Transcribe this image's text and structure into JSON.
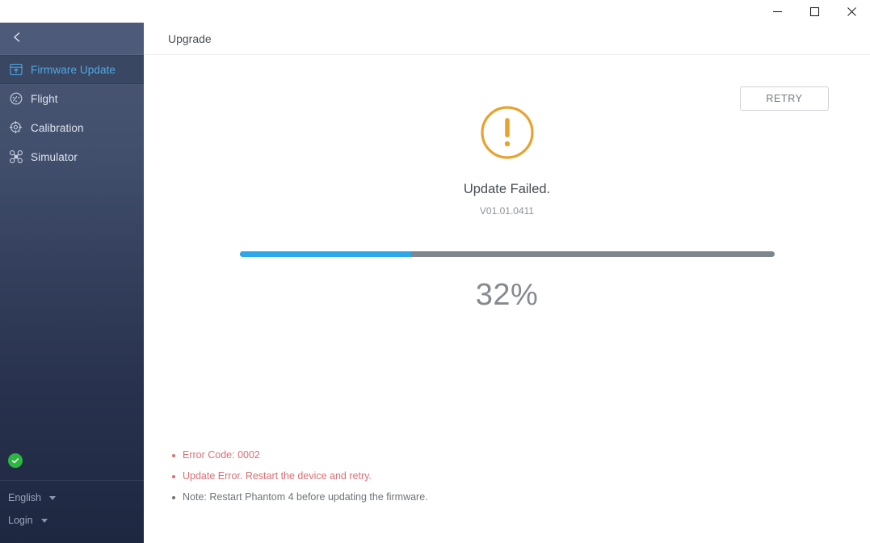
{
  "window": {
    "controls": [
      {
        "name": "minimize",
        "glyph": "minimize-icon"
      },
      {
        "name": "maximize",
        "glyph": "maximize-icon"
      },
      {
        "name": "close",
        "glyph": "close-icon"
      }
    ]
  },
  "sidebar": {
    "back_icon": "chevron-left-icon",
    "items": [
      {
        "label": "Firmware Update",
        "icon": "firmware-update-icon",
        "active": true
      },
      {
        "label": "Flight",
        "icon": "flight-gauge-icon",
        "active": false
      },
      {
        "label": "Calibration",
        "icon": "calibration-target-icon",
        "active": false
      },
      {
        "label": "Simulator",
        "icon": "drone-icon",
        "active": false
      }
    ],
    "status_icon": "connected-check-icon",
    "language": "English",
    "account": "Login"
  },
  "main": {
    "title": "Upgrade",
    "retry_label": "RETRY",
    "status_icon": "warning-exclamation-icon",
    "status_title": "Update Failed.",
    "version": "V01.01.0411",
    "progress_percent": 32,
    "progress_label": "32%",
    "messages": [
      {
        "text": "Error Code: 0002",
        "type": "error"
      },
      {
        "text": "Update Error. Restart the device and retry.",
        "type": "error"
      },
      {
        "text": "Note: Restart Phantom 4 before updating the firmware.",
        "type": "note"
      }
    ]
  },
  "colors": {
    "accent_blue": "#2ea7e8",
    "warning_orange": "#e8a22e",
    "error_red": "#d96f74",
    "sidebar_top": "#4a5775",
    "sidebar_bottom": "#1e2740",
    "active_item": "#3a4762",
    "active_text": "#4fa9e8",
    "status_green": "#2cb742"
  }
}
